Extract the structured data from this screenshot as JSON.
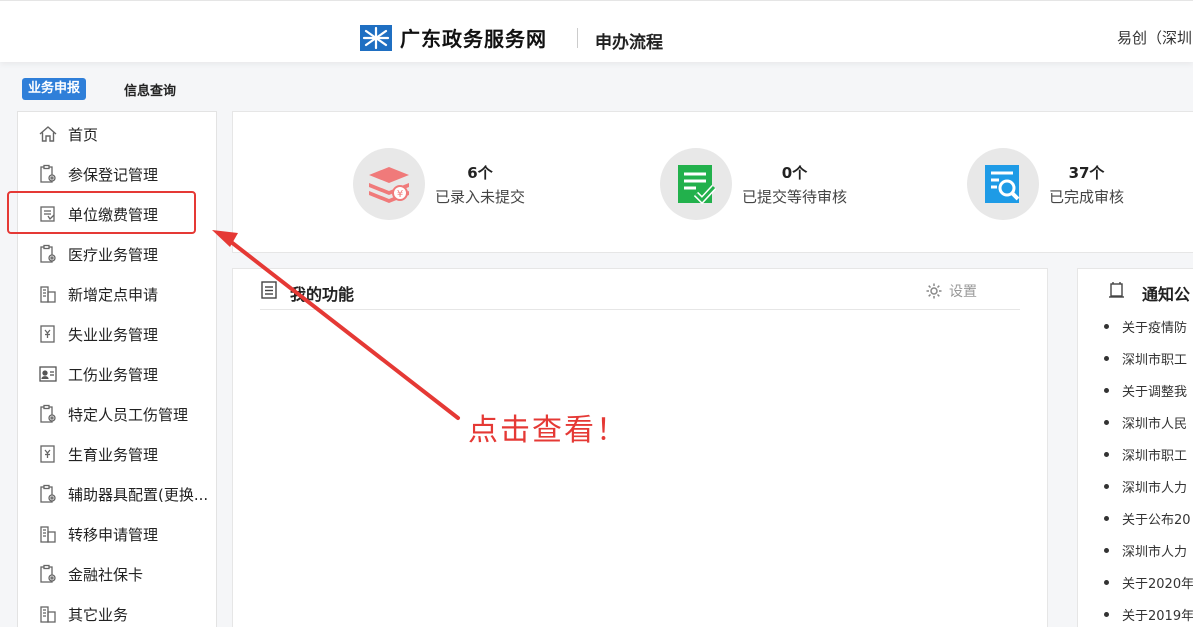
{
  "header": {
    "site_title": "广东政务服务网",
    "subtitle": "申办流程",
    "user": "易创（深圳"
  },
  "tabs": [
    {
      "label": "业务申报",
      "active": true
    },
    {
      "label": "信息查询",
      "active": false
    }
  ],
  "sidebar": {
    "items": [
      {
        "label": "首页",
        "icon": "home-icon"
      },
      {
        "label": "参保登记管理",
        "icon": "clipboard-gear-icon"
      },
      {
        "label": "单位缴费管理",
        "icon": "invoice-icon"
      },
      {
        "label": "医疗业务管理",
        "icon": "clipboard-gear-icon"
      },
      {
        "label": "新增定点申请",
        "icon": "building-icon"
      },
      {
        "label": "失业业务管理",
        "icon": "yen-document-icon"
      },
      {
        "label": "工伤业务管理",
        "icon": "id-card-icon"
      },
      {
        "label": "特定人员工伤管理",
        "icon": "clipboard-gear-icon"
      },
      {
        "label": "生育业务管理",
        "icon": "yen-document-icon"
      },
      {
        "label": "辅助器具配置(更换...",
        "icon": "clipboard-gear-icon"
      },
      {
        "label": "转移申请管理",
        "icon": "building-icon"
      },
      {
        "label": "金融社保卡",
        "icon": "clipboard-gear-icon"
      },
      {
        "label": "其它业务",
        "icon": "building-icon"
      }
    ]
  },
  "stats": [
    {
      "count": "6个",
      "label": "已录入未提交",
      "icon": "stacked-layers-icon",
      "color": "#f07a7a"
    },
    {
      "count": "0个",
      "label": "已提交等待审核",
      "icon": "document-check-icon",
      "color": "#22b14c"
    },
    {
      "count": "37个",
      "label": "已完成审核",
      "icon": "document-search-icon",
      "color": "#1e9be6"
    }
  ],
  "functions": {
    "title": "我的功能",
    "settings_label": "设置"
  },
  "notices": {
    "title": "通知公",
    "items": [
      "关于疫情防",
      "深圳市职工",
      "关于调整我",
      "深圳市人民",
      "深圳市职工",
      "深圳市人力",
      "关于公布20",
      "深圳市人力",
      "关于2020年",
      "关于2019年"
    ]
  },
  "annotation": {
    "text": "点击查看！",
    "color": "#e53935"
  }
}
